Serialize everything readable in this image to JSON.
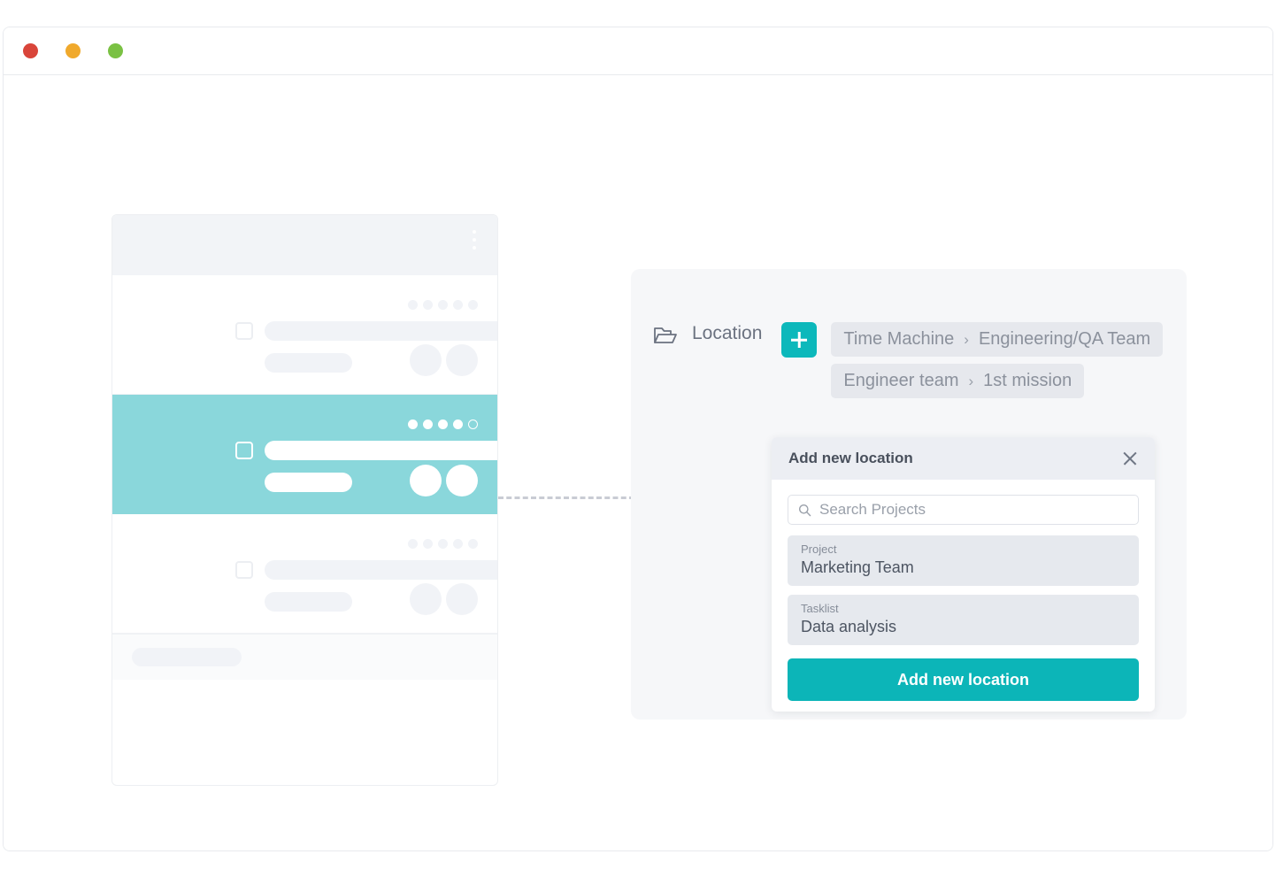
{
  "window": {
    "traffic_lights": [
      {
        "name": "close",
        "color": "#d9453a"
      },
      {
        "name": "minimize",
        "color": "#f0a92c"
      },
      {
        "name": "maximize",
        "color": "#7ac143"
      }
    ]
  },
  "task_card": {
    "menu_icon": "kebab-menu-icon",
    "rows": [
      {
        "state": "default",
        "dots": [
          true,
          true,
          true,
          true,
          true
        ]
      },
      {
        "state": "selected",
        "dots": [
          true,
          true,
          true,
          true,
          false
        ]
      },
      {
        "state": "default",
        "dots": [
          true,
          true,
          true,
          true,
          true
        ]
      }
    ]
  },
  "location_panel": {
    "folder_icon": "folder-open-icon",
    "label": "Location",
    "add_button_icon": "plus-icon",
    "breadcrumbs": [
      {
        "parent": "Time Machine",
        "separator": "›",
        "child": "Engineering/QA Team"
      },
      {
        "parent": "Engineer team",
        "separator": "›",
        "child": "1st mission"
      }
    ]
  },
  "dialog": {
    "title": "Add new location",
    "close_icon": "close-icon",
    "search": {
      "icon": "search-icon",
      "placeholder": "Search Projects",
      "value": ""
    },
    "fields": [
      {
        "label": "Project",
        "value": "Marketing Team"
      },
      {
        "label": "Tasklist",
        "value": "Data analysis"
      }
    ],
    "submit_label": "Add new location"
  },
  "colors": {
    "accent": "#0cb5b8",
    "selected_row": "#8ad7db",
    "panel_bg": "#f6f7f9",
    "chip_bg": "#e6e8ed"
  }
}
